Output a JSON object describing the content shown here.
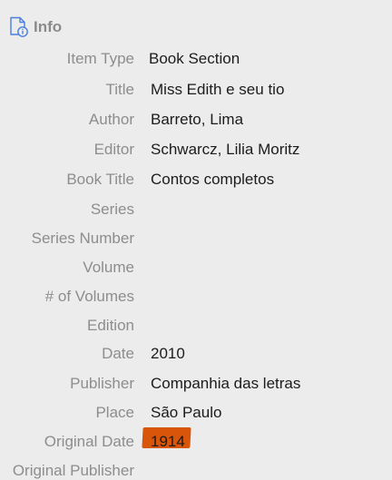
{
  "header": {
    "title": "Info",
    "icon": "document-info-icon",
    "icon_color": "#4a7fe0"
  },
  "fields": [
    {
      "label": "Item Type",
      "value": "Book Section"
    },
    {
      "label": "Title",
      "value": "Miss Edith e seu tio"
    },
    {
      "label": "Author",
      "value": "Barreto, Lima"
    },
    {
      "label": "Editor",
      "value": "Schwarcz, Lilia Moritz"
    },
    {
      "label": "Book Title",
      "value": "Contos completos"
    },
    {
      "label": "Series",
      "value": ""
    },
    {
      "label": "Series Number",
      "value": ""
    },
    {
      "label": "Volume",
      "value": ""
    },
    {
      "label": "# of Volumes",
      "value": ""
    },
    {
      "label": "Edition",
      "value": ""
    },
    {
      "label": "Date",
      "value": "2010"
    },
    {
      "label": "Publisher",
      "value": "Companhia das letras"
    },
    {
      "label": "Place",
      "value": "São Paulo"
    },
    {
      "label": "Original Date",
      "value": "1914"
    },
    {
      "label": "Original Publisher",
      "value": ""
    }
  ],
  "highlight_color": "#d9550a"
}
